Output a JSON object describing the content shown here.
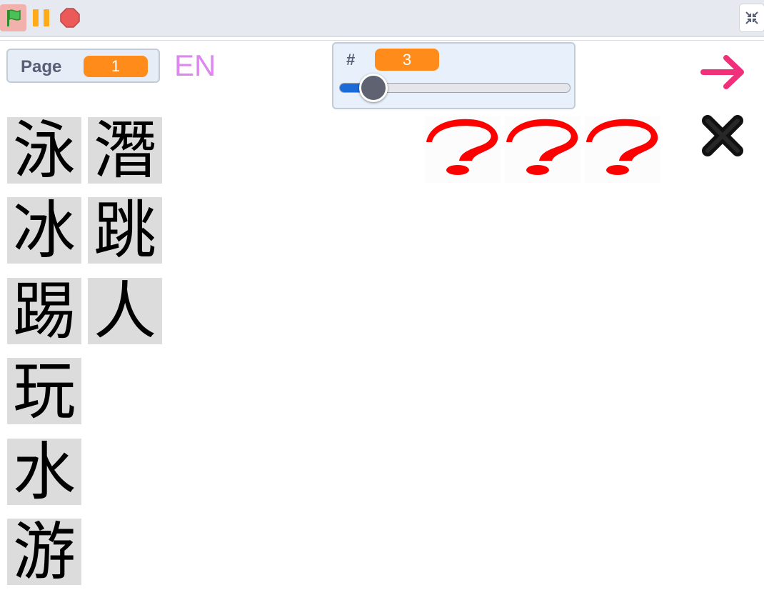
{
  "toolbar": {
    "green_flag": "green-flag",
    "pause": "pause",
    "stop": "stop",
    "fullscreen": "exit-fullscreen"
  },
  "page_monitor": {
    "label": "Page",
    "value": "1"
  },
  "language_button": "EN",
  "slider_monitor": {
    "label": "#",
    "value": "3",
    "level": 0.1
  },
  "characters": [
    "泳",
    "潛",
    "冰",
    "跳",
    "踢",
    "人",
    "玩",
    "水",
    "游"
  ],
  "placeholders": [
    "?",
    "?",
    "?"
  ],
  "colors": {
    "accent_orange": "#ff8c1a",
    "lang_pink": "#dd88ee",
    "arrow_pink": "#f0307a",
    "question_red": "#ff0000",
    "tile_gray": "#dcdcdc"
  }
}
